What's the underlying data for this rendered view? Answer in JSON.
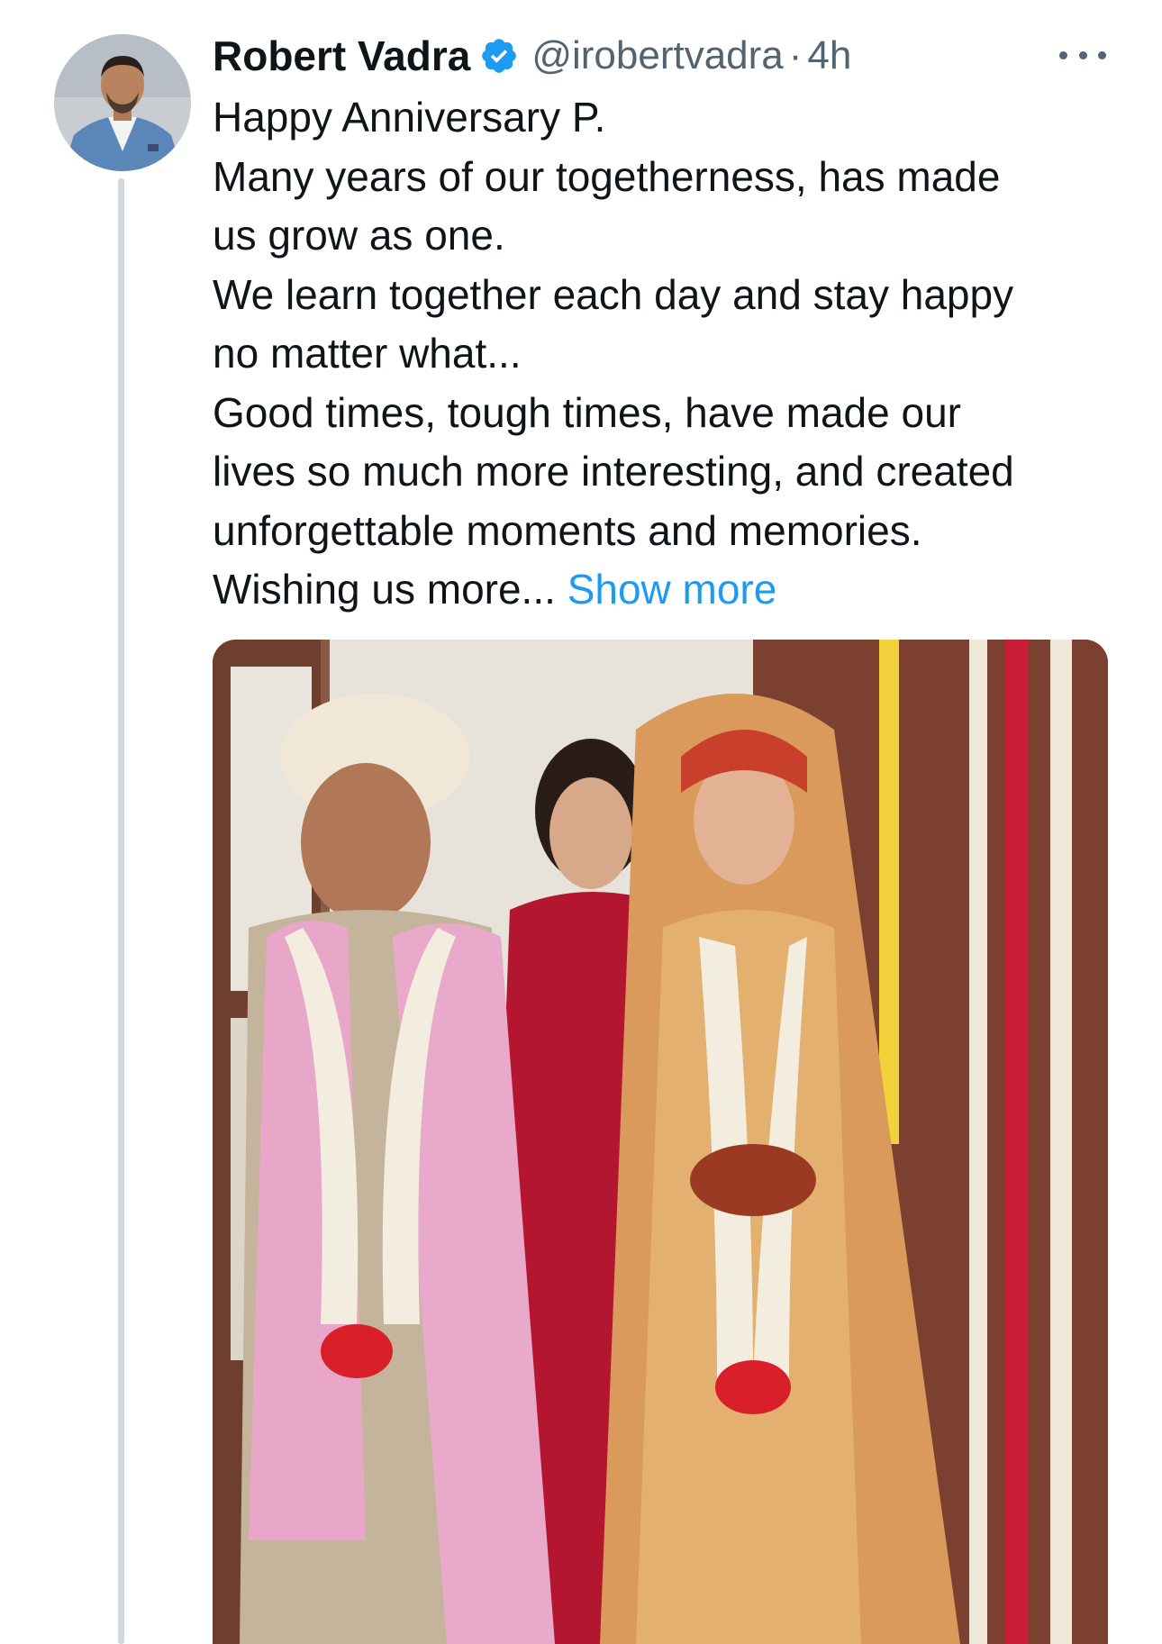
{
  "tweet": {
    "author": {
      "name": "Robert Vadra",
      "handle": "@irobertvadra",
      "verified_icon": "verified-badge-icon",
      "avatar": "avatar"
    },
    "separator": "·",
    "time": "4h",
    "more_icon": "more-options-icon",
    "text_lines": [
      "Happy Anniversary P.",
      "Many years of our togetherness, has made",
      "us grow as one.",
      "We learn together each day and stay happy",
      "no matter what...",
      "Good times, tough times, have made our",
      "lives so much more interesting, and created",
      "unforgettable moments and memories.",
      "Wishing us more..."
    ],
    "show_more_label": "Show more",
    "media": "wedding-photo"
  },
  "colors": {
    "text": "#0f1419",
    "secondary": "#536471",
    "link": "#1d9bf0",
    "verified": "#1d9bf0",
    "thread_line": "#cfd9de"
  }
}
